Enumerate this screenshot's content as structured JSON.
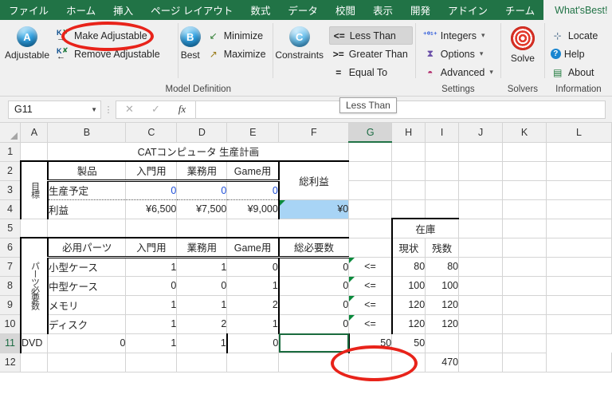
{
  "ribbon": {
    "tabs": [
      {
        "label": "ファイル",
        "active": false
      },
      {
        "label": "ホーム",
        "active": false
      },
      {
        "label": "挿入",
        "active": false
      },
      {
        "label": "ページ レイアウト",
        "active": false
      },
      {
        "label": "数式",
        "active": false
      },
      {
        "label": "データ",
        "active": false
      },
      {
        "label": "校閲",
        "active": false
      },
      {
        "label": "表示",
        "active": false
      },
      {
        "label": "開発",
        "active": false
      },
      {
        "label": "アドイン",
        "active": false
      },
      {
        "label": "チーム",
        "active": false
      },
      {
        "label": "What'sBest!",
        "active": true
      }
    ],
    "groups": [
      {
        "caption": "Model Definition",
        "big": [
          {
            "label": "Adjustable",
            "icon": "blue-orb-a-icon",
            "glyph": "A"
          },
          {
            "label": "Best",
            "icon": "blue-orb-b-icon",
            "glyph": "B"
          }
        ],
        "small": [
          {
            "label": "Make Adjustable",
            "icon": "make-adjustable-icon"
          },
          {
            "label": "Remove Adjustable",
            "icon": "remove-adjustable-icon"
          },
          {
            "label": "Minimize",
            "icon": "minimize-arrow-icon"
          },
          {
            "label": "Maximize",
            "icon": "maximize-arrow-icon"
          }
        ]
      },
      {
        "caption": "",
        "big": [
          {
            "label": "Constraints",
            "icon": "blue-orb-c-icon",
            "glyph": "C"
          }
        ],
        "small": [
          {
            "label": "Less Than",
            "icon": "less-than-icon",
            "op": "<=",
            "highlighted": true
          },
          {
            "label": "Greater Than",
            "icon": "greater-than-icon",
            "op": ">="
          },
          {
            "label": "Equal To",
            "icon": "equal-to-icon",
            "op": "="
          }
        ]
      },
      {
        "caption": "Settings",
        "small": [
          {
            "label": "Integers",
            "icon": "integers-icon",
            "dropdown": true
          },
          {
            "label": "Options",
            "icon": "options-chart-icon",
            "dropdown": true
          },
          {
            "label": "Advanced",
            "icon": "advanced-icon",
            "dropdown": true
          }
        ]
      },
      {
        "caption": "Solvers",
        "big": [
          {
            "label": "Solve",
            "icon": "solve-target-icon"
          }
        ]
      },
      {
        "caption": "Information",
        "small": [
          {
            "label": "Locate",
            "icon": "locate-icon"
          },
          {
            "label": "Help",
            "icon": "help-question-icon"
          },
          {
            "label": "About",
            "icon": "about-icon"
          }
        ]
      }
    ],
    "tooltip": "Less Than"
  },
  "formula_bar": {
    "name_box": "G11",
    "formula": "",
    "cancel_icon": "close-icon",
    "confirm_icon": "check-icon",
    "fx_icon": "fx-icon"
  },
  "sheet": {
    "columns": [
      "A",
      "B",
      "C",
      "D",
      "E",
      "F",
      "G",
      "H",
      "I",
      "J",
      "K",
      "L"
    ],
    "selected_column": "G",
    "selected_row": "11",
    "selected_cell": "G11",
    "rows": [
      {
        "num": "1",
        "cells": {
          "title": "CATコンピュータ 生産計画"
        }
      },
      {
        "num": "2",
        "cells": {
          "B": "製品",
          "C": "入門用",
          "D": "業務用",
          "E": "Game用",
          "F": "総利益"
        }
      },
      {
        "num": "3",
        "cells": {
          "A": "目標",
          "B": "生産予定",
          "C": "0",
          "D": "0",
          "E": "0"
        }
      },
      {
        "num": "4",
        "cells": {
          "B": "利益",
          "C": "¥6,500",
          "D": "¥7,500",
          "E": "¥9,000",
          "F": "¥0"
        }
      },
      {
        "num": "5",
        "cells": {}
      },
      {
        "num": "6",
        "cells": {
          "B": "必用パーツ",
          "C": "入門用",
          "D": "業務用",
          "E": "Game用",
          "F": "総必要数",
          "H": "在庫",
          "H2": "現状",
          "I2": "残数"
        }
      },
      {
        "num": "7",
        "cells": {
          "A": "パーツ必要数",
          "B": "小型ケース",
          "C": "1",
          "D": "1",
          "E": "0",
          "F": "0",
          "G": "<=",
          "H": "80",
          "I": "80"
        }
      },
      {
        "num": "8",
        "cells": {
          "B": "中型ケース",
          "C": "0",
          "D": "0",
          "E": "1",
          "F": "0",
          "G": "<=",
          "H": "100",
          "I": "100"
        }
      },
      {
        "num": "9",
        "cells": {
          "B": "メモリ",
          "C": "1",
          "D": "1",
          "E": "2",
          "F": "0",
          "G": "<=",
          "H": "120",
          "I": "120"
        }
      },
      {
        "num": "10",
        "cells": {
          "B": "ディスク",
          "C": "1",
          "D": "2",
          "E": "1",
          "F": "0",
          "G": "<=",
          "H": "120",
          "I": "120"
        }
      },
      {
        "num": "11",
        "cells": {
          "B": "DVD",
          "C": "0",
          "D": "1",
          "E": "1",
          "F": "0",
          "G": "",
          "H": "50",
          "I": "50"
        }
      },
      {
        "num": "12",
        "cells": {
          "I": "470"
        }
      }
    ],
    "inventory_header": "在庫",
    "inventory_sub": [
      "現状",
      "残数"
    ],
    "side_label_top": "目標",
    "side_label_bottom": "パーツ必要数"
  },
  "colors": {
    "ribbon_green": "#217346",
    "annotation_red": "#e8231a",
    "selection_green": "#1a6b3e",
    "highlight_blue": "#a8d4f5",
    "value_blue": "#1f4fd8"
  }
}
